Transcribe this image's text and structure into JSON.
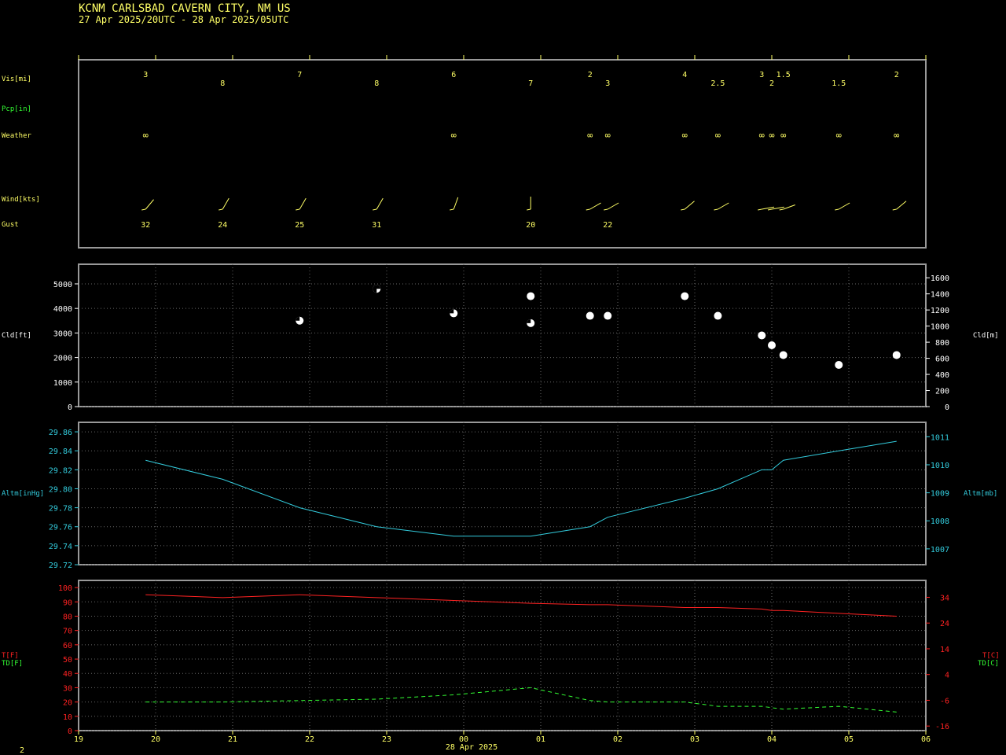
{
  "header": {
    "station": "KCNM  CARLSBAD CAVERN CITY, NM US",
    "range": "27 Apr 2025/20UTC - 28 Apr 2025/05UTC"
  },
  "date_label": "28 Apr 2025",
  "page_number": "2",
  "colors": {
    "yellow": "#ffff66",
    "green": "#33ff33",
    "cyan": "#33ccdd",
    "red": "#ff2222",
    "white": "#ffffff",
    "frame": "#999999",
    "grid": "#666666"
  },
  "labels": {
    "vis": "Vis[mi]",
    "pcp": "Pcp[in]",
    "weather": "Weather",
    "wind": "Wind[kts]",
    "gust": "Gust",
    "cld_left": "Cld[ft]",
    "cld_right": "Cld[m]",
    "altm_left": "Altm[inHg]",
    "altm_right": "Altm[mb]",
    "t_f": "T[F]",
    "td_f": "TD[F]",
    "t_c": "T[C]",
    "td_c": "TD[C]"
  },
  "chart_data": [
    {
      "type": "table",
      "title": "Observations",
      "x_ticks": [
        "19",
        "20",
        "21",
        "22",
        "23",
        "00",
        "01",
        "02",
        "03",
        "04",
        "05",
        "06"
      ],
      "vis": [
        {
          "x": 19.87,
          "v": "3"
        },
        {
          "x": 20.87,
          "v": "8"
        },
        {
          "x": 21.87,
          "v": "7"
        },
        {
          "x": 22.87,
          "v": "8"
        },
        {
          "x": 23.87,
          "v": "6"
        },
        {
          "x": 24.87,
          "v": "7"
        },
        {
          "x": 25.64,
          "v": "2"
        },
        {
          "x": 25.87,
          "v": "3"
        },
        {
          "x": 26.87,
          "v": "4"
        },
        {
          "x": 27.3,
          "v": "2.5"
        },
        {
          "x": 27.87,
          "v": "3"
        },
        {
          "x": 28.0,
          "v": "2"
        },
        {
          "x": 28.15,
          "v": "1.5"
        },
        {
          "x": 28.87,
          "v": "1.5"
        },
        {
          "x": 29.62,
          "v": "2"
        }
      ],
      "weather": [
        {
          "x": 19.87,
          "v": "∞"
        },
        {
          "x": 23.87,
          "v": "∞"
        },
        {
          "x": 25.64,
          "v": "∞"
        },
        {
          "x": 25.87,
          "v": "∞"
        },
        {
          "x": 26.87,
          "v": "∞"
        },
        {
          "x": 27.3,
          "v": "∞"
        },
        {
          "x": 27.87,
          "v": "∞"
        },
        {
          "x": 28.0,
          "v": "∞"
        },
        {
          "x": 28.15,
          "v": "∞"
        },
        {
          "x": 28.87,
          "v": "∞"
        },
        {
          "x": 29.62,
          "v": "∞"
        }
      ],
      "wind": [
        {
          "x": 19.87,
          "dir": 220
        },
        {
          "x": 20.87,
          "dir": 210
        },
        {
          "x": 21.87,
          "dir": 210
        },
        {
          "x": 22.87,
          "dir": 210
        },
        {
          "x": 23.87,
          "dir": 200
        },
        {
          "x": 24.87,
          "dir": 180
        },
        {
          "x": 25.64,
          "dir": 240
        },
        {
          "x": 25.87,
          "dir": 240
        },
        {
          "x": 26.87,
          "dir": 230
        },
        {
          "x": 27.3,
          "dir": 240
        },
        {
          "x": 27.87,
          "dir": 260
        },
        {
          "x": 28.0,
          "dir": 260
        },
        {
          "x": 28.15,
          "dir": 250
        },
        {
          "x": 28.87,
          "dir": 240
        },
        {
          "x": 29.62,
          "dir": 230
        }
      ],
      "gust": [
        {
          "x": 19.87,
          "v": "32"
        },
        {
          "x": 20.87,
          "v": "24"
        },
        {
          "x": 21.87,
          "v": "25"
        },
        {
          "x": 22.87,
          "v": "31"
        },
        {
          "x": 24.87,
          "v": "20"
        },
        {
          "x": 25.87,
          "v": "22"
        }
      ]
    },
    {
      "type": "scatter",
      "title": "",
      "ylabel": "Cld[ft]",
      "y2label": "Cld[m]",
      "ylim": [
        0,
        5800
      ],
      "y_ticks": [
        0,
        1000,
        2000,
        3000,
        4000,
        5000
      ],
      "y2_ticks": [
        0,
        200,
        400,
        600,
        800,
        1000,
        1200,
        1400,
        1600
      ],
      "points": [
        {
          "x": 21.87,
          "y": 3500,
          "cover": "BKN"
        },
        {
          "x": 22.87,
          "y": 4800,
          "cover": "SCT"
        },
        {
          "x": 23.87,
          "y": 3800,
          "cover": "BKN"
        },
        {
          "x": 24.87,
          "y": 4500,
          "cover": "OVC"
        },
        {
          "x": 24.87,
          "y": 3400,
          "cover": "BKN"
        },
        {
          "x": 25.64,
          "y": 3700,
          "cover": "OVC"
        },
        {
          "x": 25.87,
          "y": 3700,
          "cover": "OVC"
        },
        {
          "x": 26.87,
          "y": 4500,
          "cover": "OVC"
        },
        {
          "x": 27.3,
          "y": 3700,
          "cover": "OVC"
        },
        {
          "x": 27.87,
          "y": 2900,
          "cover": "OVC"
        },
        {
          "x": 28.0,
          "y": 2500,
          "cover": "OVC"
        },
        {
          "x": 28.15,
          "y": 2100,
          "cover": "OVC"
        },
        {
          "x": 28.87,
          "y": 1700,
          "cover": "OVC"
        },
        {
          "x": 29.62,
          "y": 2100,
          "cover": "OVC"
        }
      ]
    },
    {
      "type": "line",
      "title": "",
      "ylabel": "Altm[inHg]",
      "y2label": "Altm[mb]",
      "ylim": [
        29.72,
        29.87
      ],
      "y_ticks": [
        "29.72",
        "29.74",
        "29.76",
        "29.78",
        "29.80",
        "29.82",
        "29.84",
        "29.86"
      ],
      "y2_ticks": [
        "1007",
        "1008",
        "1009",
        "1010",
        "1011"
      ],
      "x": [
        19.87,
        20.87,
        21.87,
        22.87,
        23.87,
        24.87,
        25.64,
        25.87,
        26.87,
        27.3,
        27.87,
        28.0,
        28.15,
        28.87,
        29.62
      ],
      "values": [
        29.83,
        29.81,
        29.78,
        29.76,
        29.75,
        29.75,
        29.76,
        29.77,
        29.79,
        29.8,
        29.82,
        29.82,
        29.83,
        29.84,
        29.85
      ]
    },
    {
      "type": "line",
      "title": "",
      "ylabel": "T[F] / TD[F]",
      "y2label": "T[C] / TD[C]",
      "ylim": [
        0,
        105
      ],
      "y_ticks": [
        0,
        10,
        20,
        30,
        40,
        50,
        60,
        70,
        80,
        90,
        100
      ],
      "y2_ticks": [
        "-16",
        "-6",
        "4",
        "14",
        "24",
        "34"
      ],
      "x": [
        19.87,
        20.87,
        21.87,
        22.87,
        23.87,
        24.87,
        25.64,
        25.87,
        26.87,
        27.3,
        27.87,
        28.0,
        28.15,
        28.87,
        29.62
      ],
      "series": [
        {
          "name": "T[F]",
          "values": [
            95,
            93,
            95,
            93,
            91,
            89,
            88,
            88,
            86,
            86,
            85,
            84,
            84,
            82,
            80
          ]
        },
        {
          "name": "TD[F]",
          "values": [
            20,
            20,
            21,
            22,
            25,
            30,
            21,
            20,
            20,
            17,
            17,
            16,
            15,
            17,
            13
          ]
        }
      ]
    }
  ]
}
